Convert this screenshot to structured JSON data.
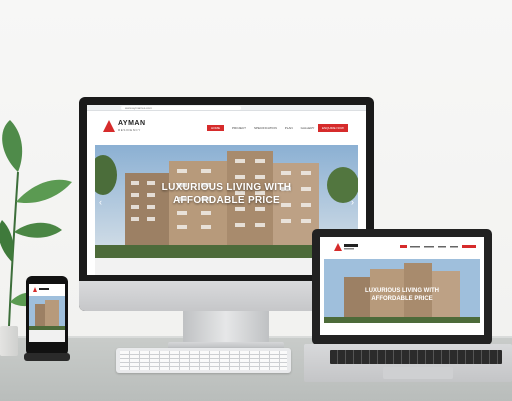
{
  "site": {
    "url": "www.aymanres.com",
    "logo_name": "AYMAN",
    "logo_sub": "RESIDENCY",
    "nav": [
      "HOME",
      "PROJECT",
      "SPECIFICATION",
      "PLAN",
      "GALLERY",
      "CONTACT"
    ],
    "active_nav": "HOME",
    "cta": "ENQUIRE NOW",
    "hero_line1": "LUXURIOUS LIVING WITH",
    "hero_line2": "AFFORDABLE PRICE"
  },
  "colors": {
    "brand": "#d62b2b",
    "sky": "#9fbfdc",
    "building": "#b89b7e"
  }
}
